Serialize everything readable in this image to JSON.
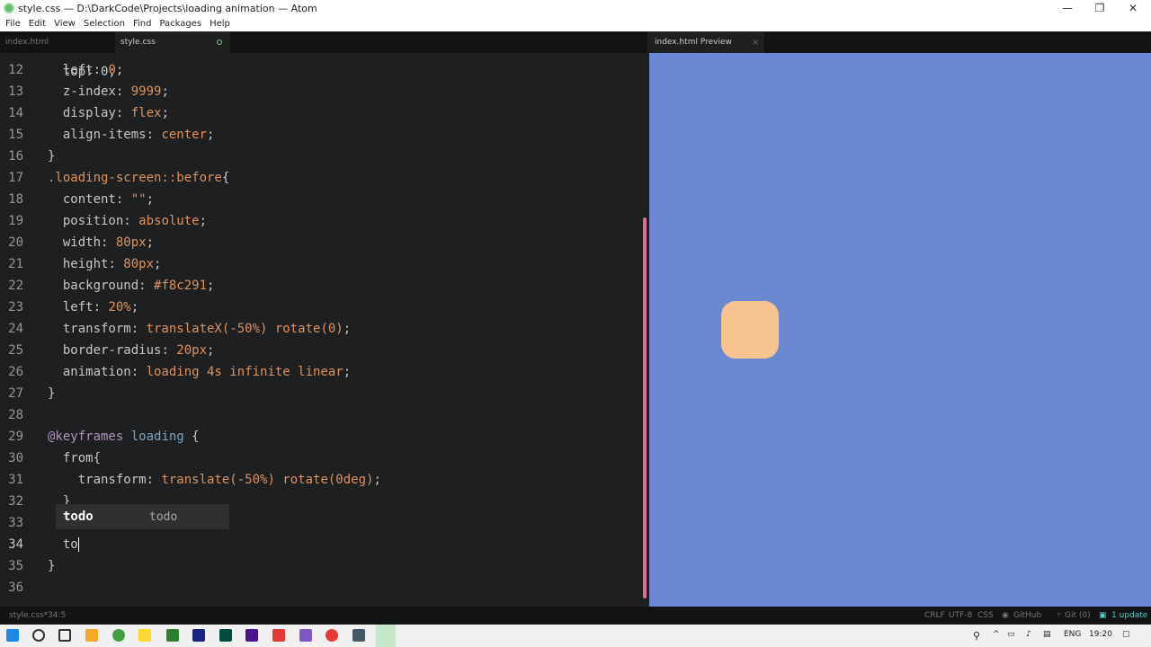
{
  "window": {
    "title": "style.css — D:\\DarkCode\\Projects\\loading animation — Atom",
    "minimize_icon": "—",
    "restore_icon": "❐",
    "close_icon": "✕"
  },
  "menu": [
    "File",
    "Edit",
    "View",
    "Selection",
    "Find",
    "Packages",
    "Help"
  ],
  "tabs": {
    "left": [
      {
        "label": "index.html"
      },
      {
        "label": "style.css"
      }
    ],
    "preview": {
      "label": "index.html Preview",
      "close": "×"
    }
  },
  "editor": {
    "lines": [
      {
        "num": "12",
        "code": "  left: 0;"
      },
      {
        "num": "13",
        "code": "  z-index: 9999;"
      },
      {
        "num": "14",
        "code": "  display: flex;"
      },
      {
        "num": "15",
        "code": "  align-items: center;"
      },
      {
        "num": "16",
        "code": "}"
      },
      {
        "num": "17",
        "code": ".loading-screen::before{"
      },
      {
        "num": "18",
        "code": "  content: \"\";"
      },
      {
        "num": "19",
        "code": "  position: absolute;"
      },
      {
        "num": "20",
        "code": "  width: 80px;"
      },
      {
        "num": "21",
        "code": "  height: 80px;"
      },
      {
        "num": "22",
        "code": "  background: #f8c291;"
      },
      {
        "num": "23",
        "code": "  left: 20%;"
      },
      {
        "num": "24",
        "code": "  transform: translateX(-50%) rotate(0);"
      },
      {
        "num": "25",
        "code": "  border-radius: 20px;"
      },
      {
        "num": "26",
        "code": "  animation: loading 4s infinite linear;"
      },
      {
        "num": "27",
        "code": "}"
      },
      {
        "num": "28",
        "code": ""
      },
      {
        "num": "29",
        "code": "@keyframes loading {"
      },
      {
        "num": "30",
        "code": "  from{"
      },
      {
        "num": "31",
        "code": "    transform: translate(-50%) rotate(0deg);"
      },
      {
        "num": "32",
        "code": "  }"
      },
      {
        "num": "33",
        "code": ""
      },
      {
        "num": "34",
        "code": "  to"
      },
      {
        "num": "35",
        "code": "}"
      },
      {
        "num": "36",
        "code": ""
      }
    ],
    "autocomplete": {
      "suggestion": "todo",
      "hint": "todo"
    }
  },
  "statusbar": {
    "file": "style.css*",
    "position": "34:5",
    "line_ending": "CRLF",
    "encoding": "UTF-8",
    "grammar": "CSS",
    "github": "GitHub",
    "git": "Git (0)",
    "update": "1 update"
  },
  "taskbar": {
    "language": "ENG",
    "time": "19:20"
  },
  "colors": {
    "preview_bg": "#6b89d3",
    "box": "#f8c291",
    "scrollbar": "#e46b8f"
  }
}
